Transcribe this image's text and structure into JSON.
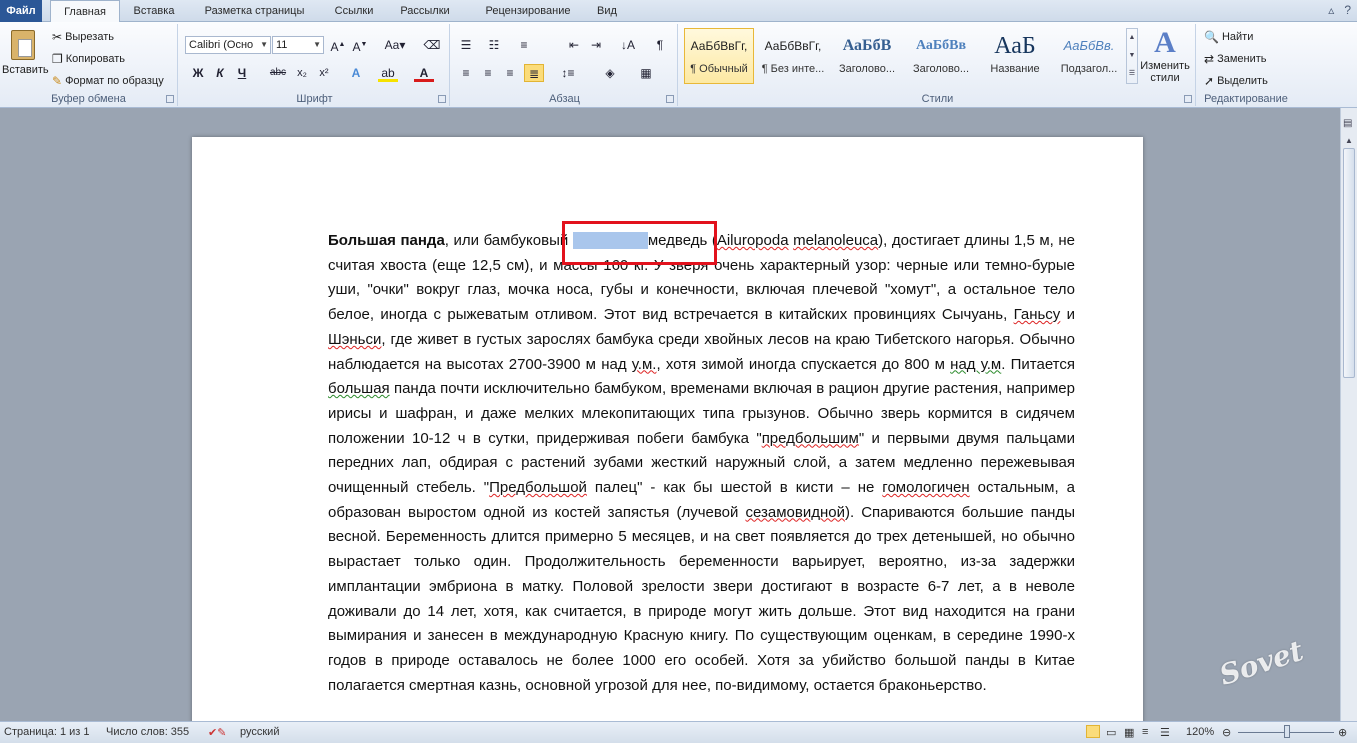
{
  "tabs": [
    {
      "label": "Файл"
    },
    {
      "label": "Главная"
    },
    {
      "label": "Вставка"
    },
    {
      "label": "Разметка страницы"
    },
    {
      "label": "Ссылки"
    },
    {
      "label": "Рассылки"
    },
    {
      "label": "Рецензирование"
    },
    {
      "label": "Вид"
    }
  ],
  "clipboard": {
    "paste": "Вставить",
    "cut": "Вырезать",
    "copy": "Копировать",
    "format_painter": "Формат по образцу",
    "group_label": "Буфер обмена"
  },
  "font": {
    "name": "Calibri (Осно",
    "size": "11",
    "group_label": "Шрифт",
    "bold": "Ж",
    "italic": "К",
    "underline": "Ч"
  },
  "paragraph": {
    "group_label": "Абзац"
  },
  "styles": {
    "items": [
      {
        "sample": "АаБбВвГг,",
        "name": "¶ Обычный"
      },
      {
        "sample": "АаБбВвГг,",
        "name": "¶ Без инте..."
      },
      {
        "sample": "АаБбВ",
        "name": "Заголово..."
      },
      {
        "sample": "АаБбВв",
        "name": "Заголово..."
      },
      {
        "sample": "АаБ",
        "name": "Название"
      },
      {
        "sample": "АаБбВв.",
        "name": "Подзагол..."
      }
    ],
    "change_styles": "Изменить стили",
    "group_label": "Стили"
  },
  "editing": {
    "find": "Найти",
    "replace": "Заменить",
    "select": "Выделить",
    "group_label": "Редактирование"
  },
  "document": {
    "bold_title": "Большая панда",
    "t1": ", или бамбуковый ",
    "t2": "медведь (",
    "t3": "Ailuropoda",
    "t4": " ",
    "t5": "melanoleuca",
    "t6": "), достигает длины 1,5 м, не считая хвоста (еще 12,5 см), и массы 160 кг.  У зверя очень характерный узор: черные или темно-бурые уши, \"очки\" вокруг глаз, мочка носа, губы и конечности, включая плечевой \"хомут\", а остальное тело белое, иногда с рыжеватым отливом. Этот вид встречается в китайских провинциях Сычуань, ",
    "t7": "Ганьсу",
    "t8": " и ",
    "t9": "Шэньси",
    "t10": ", где живет в густых зарослях бамбука среди хвойных лесов на краю Тибетского нагорья. Обычно наблюдается на высотах 2700-3900 м над ",
    "t11": "у.м.",
    "t12": ", хотя зимой иногда спускается до 800 м ",
    "t13": "над у.м",
    "t14": ". Питается ",
    "t15": "большая",
    "t16": " панда почти исключительно бамбуком, временами включая в рацион другие растения, например ирисы и шафран, и даже мелких млекопитающих типа грызунов. Обычно зверь кормится в сидячем положении 10-12 ч в сутки, придерживая побеги бамбука \"",
    "t17": "предбольшим",
    "t18": "\" и первыми двумя пальцами передних лап, обдирая с растений зубами жесткий наружный слой, а затем медленно пережевывая очищенный стебель. \"",
    "t19": "Предбольшой",
    "t20": " палец\" - как бы шестой в кисти – не ",
    "t21": "гомологичен",
    "t22": " остальным, а образован выростом одной из костей запястья (лучевой ",
    "t23": "сезамовидной",
    "t24": "). Спариваются большие панды весной. Беременность длится примерно 5 месяцев, и на свет появляется до трех детенышей, но обычно вырастает только один. Продолжительность беременности варьирует, вероятно, из-за задержки имплантации эмбриона в матку. Половой зрелости звери достигают в возрасте 6-7 лет, а в неволе доживали до 14 лет, хотя, как считается, в природе могут жить дольше. Этот вид находится на грани вымирания и занесен в международную Красную книгу. По существующим оценкам, в середине 1990-х годов в природе оставалось не более 1000 его особей. Хотя за убийство большой панды в Китае полагается смертная казнь, основной угрозой для нее, по-видимому, остается браконьерство."
  },
  "status": {
    "page": "Страница: 1 из 1",
    "words": "Число слов: 355",
    "language": "русский",
    "zoom": "120%"
  },
  "colors": {
    "file_tab": "#2b5797",
    "selection": "#a9c6ec",
    "annotation_box": "#e2121d"
  }
}
